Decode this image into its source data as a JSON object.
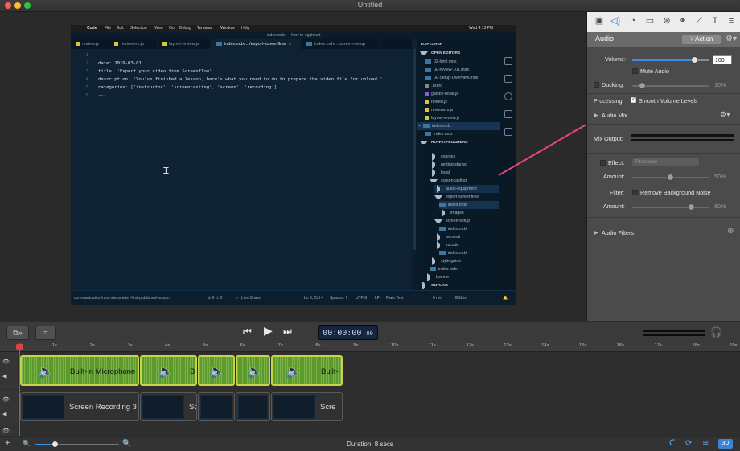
{
  "window": {
    "title": "Untitled"
  },
  "vscode": {
    "menubar": [
      "Code",
      "File",
      "Edit",
      "Selection",
      "View",
      "Go",
      "Debug",
      "Terminal",
      "Window",
      "Help"
    ],
    "clock": "Wed 4:13 PM",
    "title": "index.mdx — how-to-egghead",
    "tabs": [
      "review.js",
      "reviewers.js",
      "layout-review.js",
      "index.mdx .../export-screenflow",
      "index.mdx ...screen-setup"
    ],
    "lines": [
      {
        "n": "1",
        "t": "---"
      },
      {
        "n": "2",
        "t": "date: 2019-03-01"
      },
      {
        "n": "3",
        "t": "title: 'Export your video from Screenflow'"
      },
      {
        "n": "4",
        "t": "description: 'You've finished a lesson, here's what you need to do to prepare the video file for upload.'"
      },
      {
        "n": "5",
        "t": "categories: ['instructor', 'screencasting', 'screen', 'recording']"
      },
      {
        "n": "6",
        "t": "---"
      }
    ],
    "explorer": {
      "header": "EXPLORER",
      "open_editors": "OPEN EDITORS",
      "open_files": [
        "02-html.mdx",
        "00-review-101.mdx",
        "00-Setup-Overview.mdx",
        ".zshrc",
        "gatsby-node.js",
        "review.js",
        "reviewers.js",
        "layout-review.js",
        "index.mdx",
        "index.mdx"
      ],
      "project": "HOW-TO-EGGHEAD",
      "tree": [
        "courses",
        "getting-started",
        "legal",
        "screencasting",
        "audio-equipment",
        "export-screenflow",
        "index.mdx",
        "images",
        "screen-setup",
        "index.mdx",
        "terminal",
        "vscode",
        "index.mdx",
        "style-guide",
        "index.mdx",
        "learner"
      ],
      "outline": "OUTLINE"
    },
    "status": {
      "branch": "communication/next-steps-after-first-published-lesson",
      "pos": "Ln 6, Col 4",
      "spaces": "Spaces: 1",
      "enc": "UTF-8",
      "eol": "LF",
      "lang": "Plain Text",
      "time": "6 min",
      "lint": "ESLint",
      "share": "Live Share"
    }
  },
  "audio_panel": {
    "title": "Audio",
    "action_label": "+ Action",
    "volume_label": "Volume:",
    "volume_value": "100",
    "volume_level": 0.8,
    "mute_label": "Mute Audio",
    "ducking_label": "Ducking:",
    "ducking_value": "10%",
    "processing_label": "Processing:",
    "smooth_label": "Smooth Volume Levels",
    "audio_mix_label": "Audio Mix",
    "mix_output_label": "Mix Output:",
    "effect_label": "Effect:",
    "effect_value": "Presence",
    "amount_label": "Amount:",
    "amount1_value": "50%",
    "filter_label": "Filter:",
    "remove_noise_label": "Remove Background Noise",
    "amount2_value": "80%",
    "audio_filters_label": "Audio Filters"
  },
  "toolbar": {
    "timecode": "00:00:00",
    "timecode_frames": "00"
  },
  "ruler": [
    "1s",
    "2s",
    "3s",
    "4s",
    "5s",
    "6s",
    "7s",
    "8s",
    "9s",
    "10s",
    "11s",
    "12s",
    "13s",
    "14s",
    "15s",
    "16s",
    "17s",
    "18s",
    "19s"
  ],
  "audio_clips": [
    "Built-in Microphone",
    "Bu",
    "",
    "",
    "Built-i"
  ],
  "video_clips": [
    "Screen Recording 3",
    "Sc",
    "",
    "",
    "Scre"
  ],
  "bottom": {
    "duration": "Duration: 8 secs"
  }
}
